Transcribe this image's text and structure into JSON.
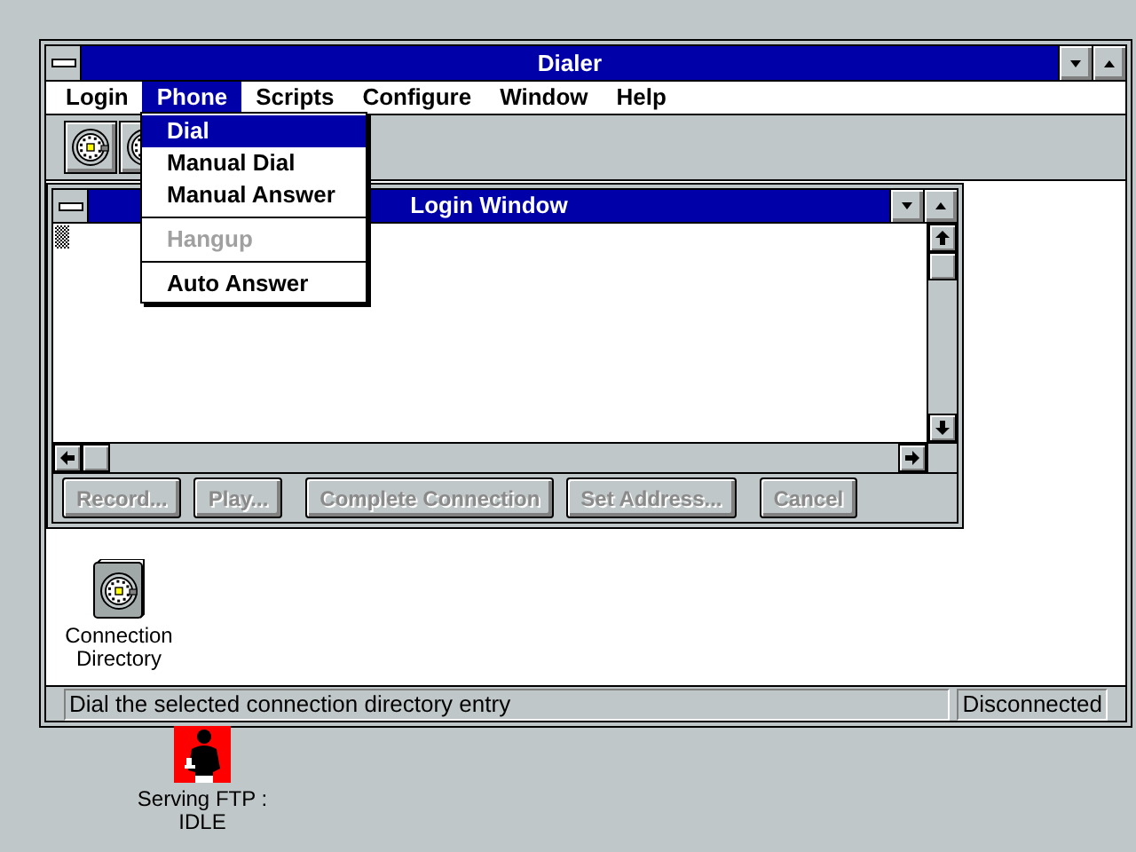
{
  "window": {
    "title": "Dialer"
  },
  "menu_bar": [
    {
      "label": "Login",
      "selected": false
    },
    {
      "label": "Phone",
      "selected": true
    },
    {
      "label": "Scripts",
      "selected": false
    },
    {
      "label": "Configure",
      "selected": false
    },
    {
      "label": "Window",
      "selected": false
    },
    {
      "label": "Help",
      "selected": false
    }
  ],
  "phone_menu": {
    "items": [
      {
        "kind": "item",
        "label": "Dial",
        "selected": true,
        "disabled": false
      },
      {
        "kind": "item",
        "label": "Manual Dial",
        "selected": false,
        "disabled": false
      },
      {
        "kind": "item",
        "label": "Manual Answer",
        "selected": false,
        "disabled": false
      },
      {
        "kind": "separator"
      },
      {
        "kind": "item",
        "label": "Hangup",
        "selected": false,
        "disabled": true
      },
      {
        "kind": "separator"
      },
      {
        "kind": "item",
        "label": "Auto Answer",
        "selected": false,
        "disabled": false
      }
    ]
  },
  "toolbar": {
    "buttons": [
      {
        "kind": "dial"
      },
      {
        "kind": "dial"
      }
    ]
  },
  "login_window": {
    "title": "Login Window",
    "buttons": [
      {
        "label": "Record...",
        "disabled": true
      },
      {
        "label": "Play...",
        "disabled": true
      },
      {
        "label": "Complete Connection",
        "disabled": true
      },
      {
        "label": "Set Address...",
        "disabled": true
      },
      {
        "label": "Cancel",
        "disabled": true
      }
    ]
  },
  "client_icons": [
    {
      "kind": "dial",
      "label_lines": [
        "Connection",
        "Directory"
      ]
    }
  ],
  "status_bar": {
    "message": "Dial the selected connection directory entry",
    "state": "Disconnected"
  },
  "desktop_icons": [
    {
      "kind": "person",
      "label_lines": [
        "Serving FTP :",
        "IDLE"
      ]
    }
  ]
}
